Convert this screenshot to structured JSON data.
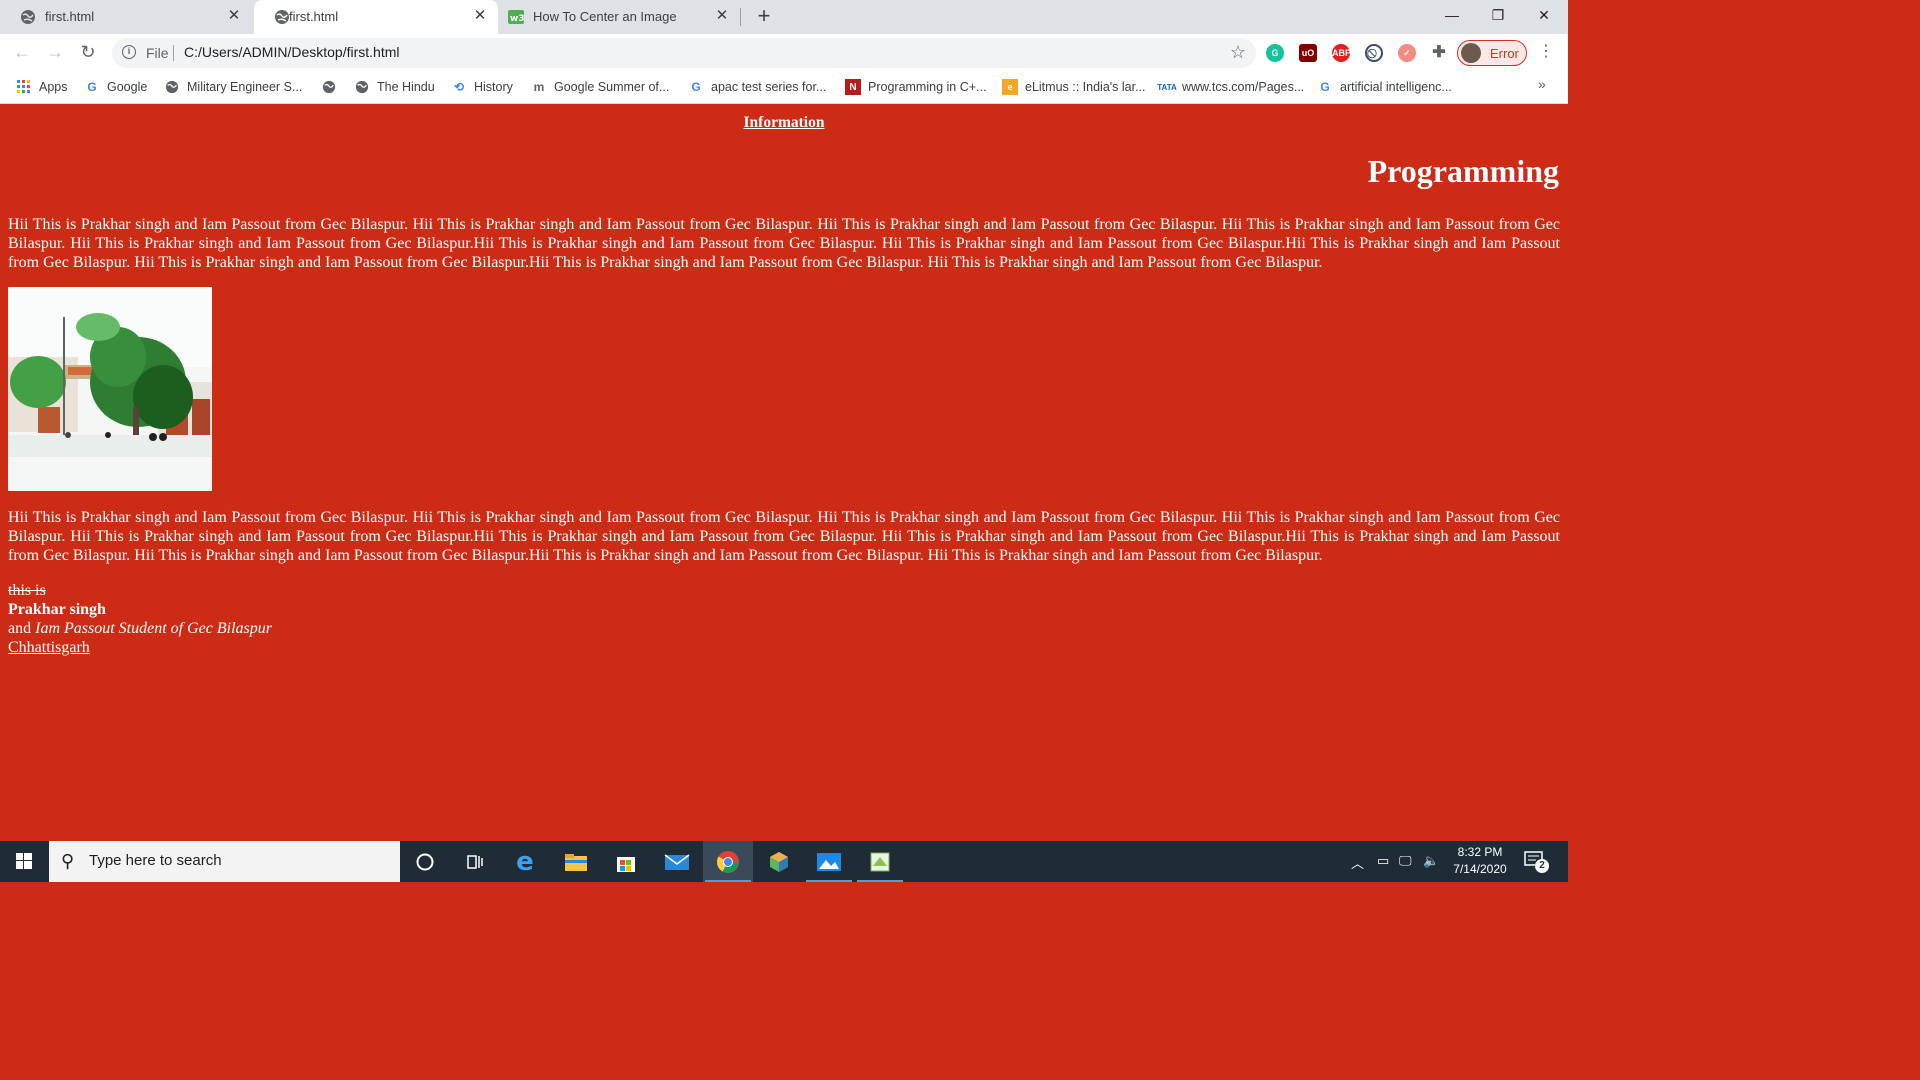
{
  "browser": {
    "tabs": [
      {
        "title": "first.html",
        "icon": "globe-icon",
        "active": false
      },
      {
        "title": "first.html",
        "icon": "globe-icon",
        "active": true
      },
      {
        "title": "How To Center an Image",
        "icon": "w3schools-icon",
        "active": false
      }
    ],
    "new_tab": "+",
    "window_controls": {
      "minimize": "—",
      "maximize": "❐",
      "close": "✕"
    },
    "omnibox": {
      "scheme_label": "File",
      "url": "C:/Users/ADMIN/Desktop/first.html"
    },
    "profile_label": "Error",
    "bookmarks": [
      {
        "label": "Apps",
        "icon": "apps-grid-icon"
      },
      {
        "label": "Google",
        "icon": "google-icon"
      },
      {
        "label": "Military Engineer S...",
        "icon": "globe-icon"
      },
      {
        "label": "",
        "icon": "globe-icon"
      },
      {
        "label": "The Hindu",
        "icon": "globe-icon"
      },
      {
        "label": "History",
        "icon": "history-icon"
      },
      {
        "label": "Google Summer of...",
        "icon": "m-icon"
      },
      {
        "label": "apac test series for...",
        "icon": "google-icon"
      },
      {
        "label": "Programming in C+...",
        "icon": "n-icon"
      },
      {
        "label": "eLitmus :: India's lar...",
        "icon": "elitmus-icon"
      },
      {
        "label": "www.tcs.com/Pages...",
        "icon": "tata-icon"
      },
      {
        "label": "artificial intelligenc...",
        "icon": "google-icon"
      }
    ],
    "bookmarks_more": "»"
  },
  "page": {
    "background": "#cc2b16",
    "information_heading": "Information",
    "programming_heading": "Programming",
    "paragraph1": "Hii This is Prakhar singh and Iam Passout from Gec Bilaspur. Hii This is Prakhar singh and Iam Passout from Gec Bilaspur. Hii This is Prakhar singh and Iam Passout from Gec Bilaspur. Hii This is Prakhar singh and Iam Passout from Gec Bilaspur. Hii This is Prakhar singh and Iam Passout from Gec Bilaspur.Hii This is Prakhar singh and Iam Passout from Gec Bilaspur. Hii This is Prakhar singh and Iam Passout from Gec Bilaspur.Hii This is Prakhar singh and Iam Passout from Gec Bilaspur. Hii This is Prakhar singh and Iam Passout from Gec Bilaspur.Hii This is Prakhar singh and Iam Passout from Gec Bilaspur. Hii This is Prakhar singh and Iam Passout from Gec Bilaspur.",
    "paragraph2": "Hii This is Prakhar singh and Iam Passout from Gec Bilaspur. Hii This is Prakhar singh and Iam Passout from Gec Bilaspur. Hii This is Prakhar singh and Iam Passout from Gec Bilaspur. Hii This is Prakhar singh and Iam Passout from Gec Bilaspur. Hii This is Prakhar singh and Iam Passout from Gec Bilaspur.Hii This is Prakhar singh and Iam Passout from Gec Bilaspur. Hii This is Prakhar singh and Iam Passout from Gec Bilaspur.Hii This is Prakhar singh and Iam Passout from Gec Bilaspur. Hii This is Prakhar singh and Iam Passout from Gec Bilaspur.Hii This is Prakhar singh and Iam Passout from Gec Bilaspur. Hii This is Prakhar singh and Iam Passout from Gec Bilaspur.",
    "signature": {
      "struck": "this is",
      "name": "Prakhar singh",
      "and_word": "and",
      "italic": "Iam Passout Student of Gec Bilaspur",
      "underlined": "Chhattisgarh"
    }
  },
  "taskbar": {
    "search_placeholder": "Type here to search",
    "apps": [
      "cortana-icon",
      "task-view-icon",
      "edge-icon",
      "file-explorer-icon",
      "store-icon",
      "mail-icon",
      "chrome-icon",
      "app-cube-icon",
      "photos-icon",
      "notepad-icon"
    ],
    "active_app": "chrome-icon",
    "time": "8:32 PM",
    "date": "7/14/2020",
    "notification_count": "2"
  }
}
